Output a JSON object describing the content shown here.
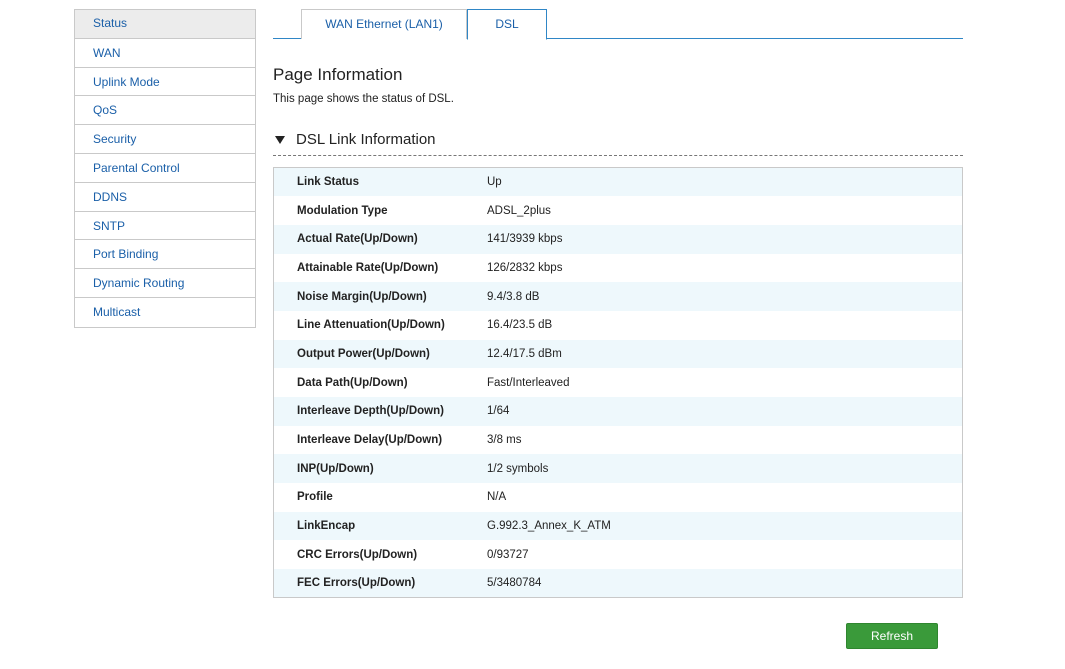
{
  "sidebar": {
    "items": [
      {
        "label": "Status"
      },
      {
        "label": "WAN"
      },
      {
        "label": "Uplink Mode"
      },
      {
        "label": "QoS"
      },
      {
        "label": "Security"
      },
      {
        "label": "Parental Control"
      },
      {
        "label": "DDNS"
      },
      {
        "label": "SNTP"
      },
      {
        "label": "Port Binding"
      },
      {
        "label": "Dynamic Routing"
      },
      {
        "label": "Multicast"
      }
    ],
    "active_index": 0
  },
  "tabs": [
    {
      "label": "WAN Ethernet (LAN1)"
    },
    {
      "label": "DSL"
    }
  ],
  "active_tab_index": 1,
  "page": {
    "title": "Page Information",
    "description": "This page shows the status of DSL."
  },
  "section": {
    "title": "DSL Link Information",
    "expanded": true
  },
  "dsl_info": [
    {
      "label": "Link Status",
      "value": "Up"
    },
    {
      "label": "Modulation Type",
      "value": "ADSL_2plus"
    },
    {
      "label": "Actual Rate(Up/Down)",
      "value": "141/3939 kbps"
    },
    {
      "label": "Attainable Rate(Up/Down)",
      "value": "126/2832 kbps"
    },
    {
      "label": "Noise Margin(Up/Down)",
      "value": "9.4/3.8 dB"
    },
    {
      "label": "Line Attenuation(Up/Down)",
      "value": "16.4/23.5 dB"
    },
    {
      "label": "Output Power(Up/Down)",
      "value": "12.4/17.5 dBm"
    },
    {
      "label": "Data Path(Up/Down)",
      "value": "Fast/Interleaved"
    },
    {
      "label": "Interleave Depth(Up/Down)",
      "value": "1/64"
    },
    {
      "label": "Interleave Delay(Up/Down)",
      "value": "3/8 ms"
    },
    {
      "label": "INP(Up/Down)",
      "value": "1/2 symbols"
    },
    {
      "label": "Profile",
      "value": "N/A"
    },
    {
      "label": "LinkEncap",
      "value": "G.992.3_Annex_K_ATM"
    },
    {
      "label": "CRC Errors(Up/Down)",
      "value": "0/93727"
    },
    {
      "label": "FEC Errors(Up/Down)",
      "value": "5/3480784"
    }
  ],
  "buttons": {
    "refresh_label": "Refresh"
  },
  "colors": {
    "link": "#1a5fa8",
    "tab_border": "#2f86c6",
    "row_alt": "#eef8fc",
    "button": "#3a9a3a"
  }
}
